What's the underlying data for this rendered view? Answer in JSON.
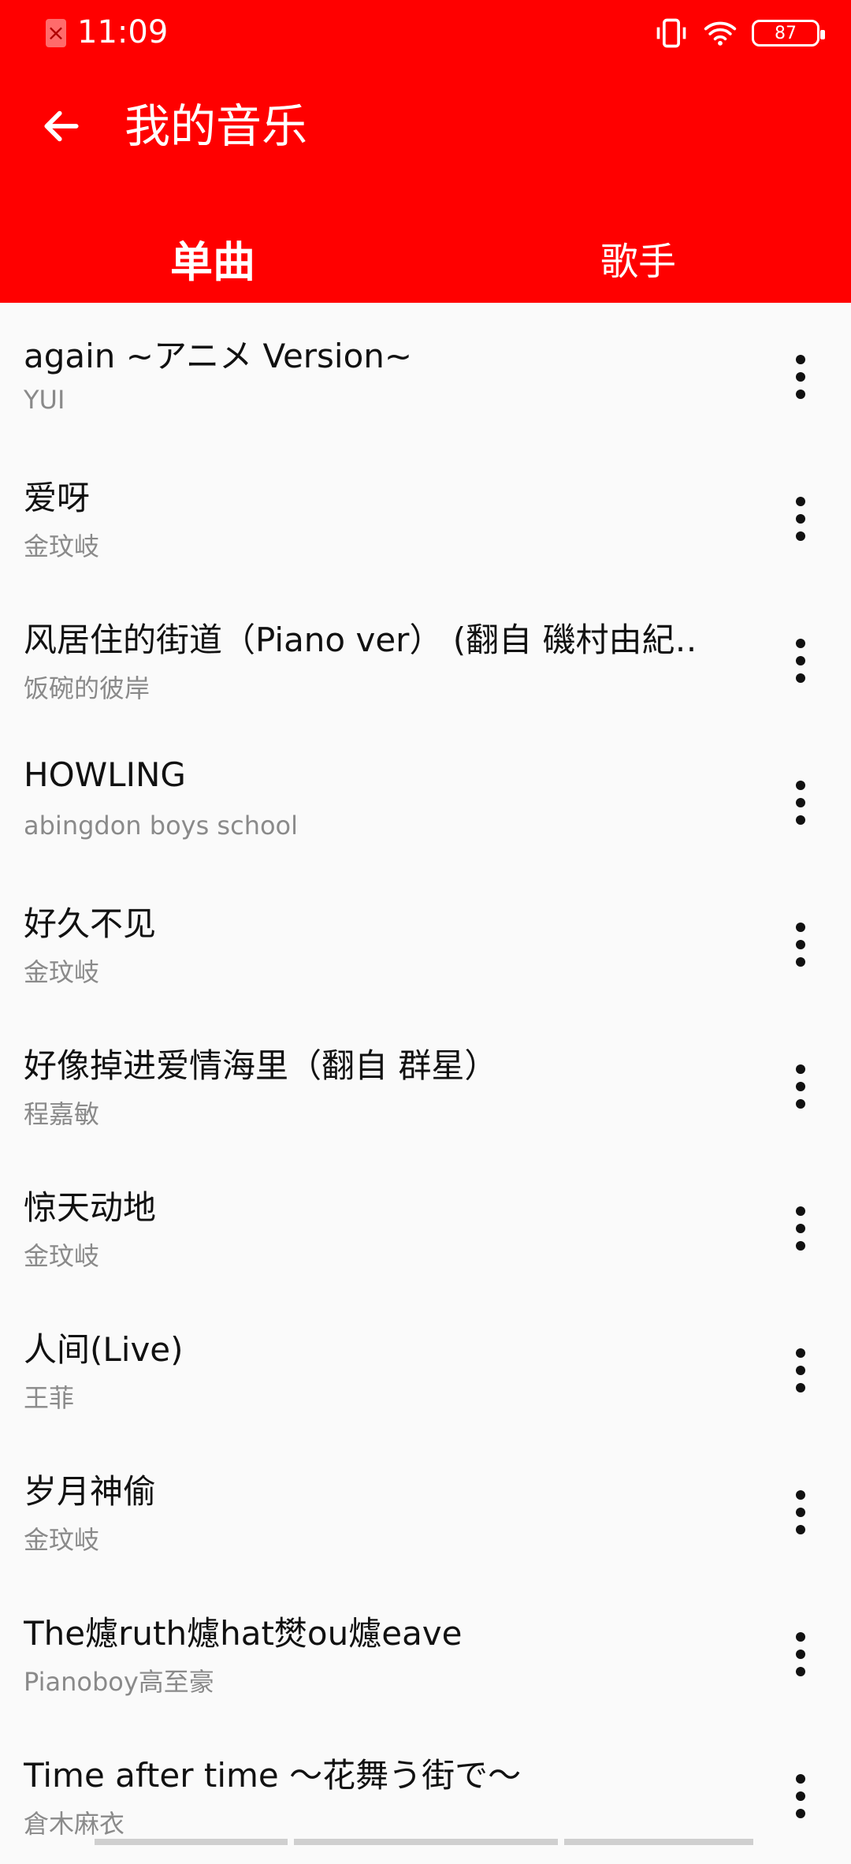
{
  "status_bar": {
    "time": "11:09",
    "battery": "87"
  },
  "header": {
    "title": "我的音乐",
    "tabs": [
      {
        "label": "单曲"
      },
      {
        "label": "歌手"
      }
    ]
  },
  "songs": [
    {
      "title": "again ~アニメ Version~",
      "artist": "YUI"
    },
    {
      "title": "爱呀",
      "artist": "金玟岐"
    },
    {
      "title": "风居住的街道（Piano ver） (翻自 磯村由紀‥",
      "artist": "饭碗的彼岸"
    },
    {
      "title": "HOWLING",
      "artist": "abingdon boys school"
    },
    {
      "title": "好久不见",
      "artist": "金玟岐"
    },
    {
      "title": "好像掉进爱情海里（翻自 群星）",
      "artist": "程嘉敏"
    },
    {
      "title": "惊天动地",
      "artist": "金玟岐"
    },
    {
      "title": "人间(Live)",
      "artist": "王菲"
    },
    {
      "title": "岁月神偷",
      "artist": "金玟岐"
    },
    {
      "title": "The爈ruth爈hat燓ou爈eave",
      "artist": "Pianoboy高至豪"
    },
    {
      "title": "Time after time ～花舞う街で～",
      "artist": "倉木麻衣"
    }
  ],
  "colors": {
    "primary": "#ff0000",
    "title_text": "#111111",
    "sub_text": "#8a8a8a",
    "background": "#fafafa"
  }
}
